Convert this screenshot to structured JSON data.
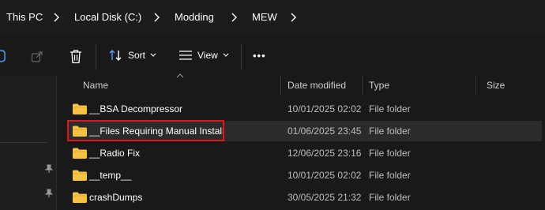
{
  "breadcrumb": {
    "items": [
      "This PC",
      "Local Disk (C:)",
      "Modding",
      "MEW"
    ]
  },
  "toolbar": {
    "sort_label": "Sort",
    "view_label": "View",
    "more_label": "•••"
  },
  "columns": {
    "name": "Name",
    "date": "Date modified",
    "type": "Type",
    "size": "Size"
  },
  "files": [
    {
      "name": "__BSA Decompressor",
      "date": "10/01/2025 02:02",
      "type": "File folder"
    },
    {
      "name": "__Files Requiring Manual Install",
      "date": "01/06/2025 23:45",
      "type": "File folder"
    },
    {
      "name": "__Radio Fix",
      "date": "12/06/2025 23:16",
      "type": "File folder"
    },
    {
      "name": "__temp__",
      "date": "10/01/2025 02:02",
      "type": "File folder"
    },
    {
      "name": "crashDumps",
      "date": "30/05/2025 21:32",
      "type": "File folder"
    }
  ],
  "colors": {
    "highlight": "#e2141c",
    "folder": "#f5c342"
  }
}
